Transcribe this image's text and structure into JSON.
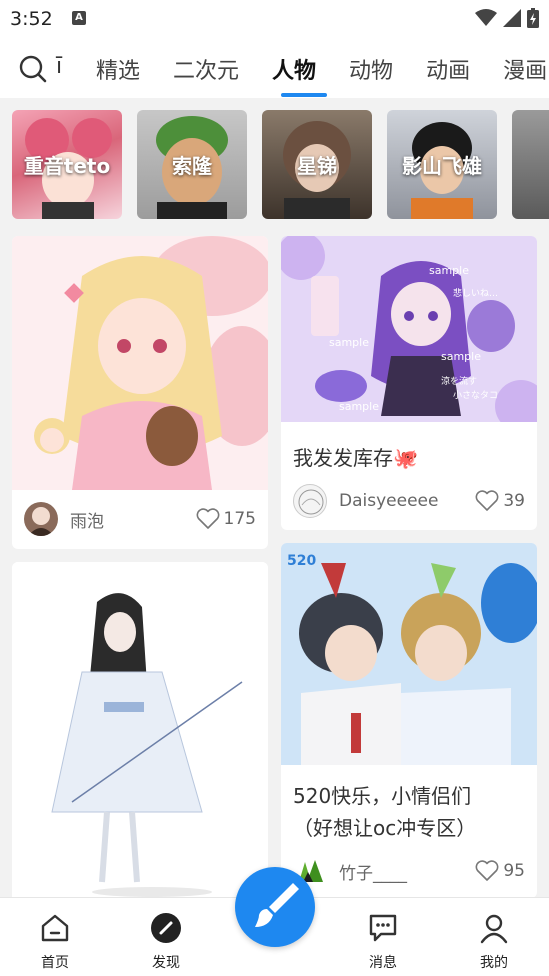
{
  "status_bar": {
    "time": "3:52",
    "notif_icon_letter": "A"
  },
  "tabs": {
    "partial_left": "ī",
    "items": [
      "精选",
      "二次元",
      "人物",
      "动物",
      "动画",
      "漫画"
    ],
    "active": "人物"
  },
  "characters": [
    {
      "label": "重音teto",
      "color": "#d9667a"
    },
    {
      "label": "索隆",
      "color": "#4d7a3a"
    },
    {
      "label": "星锑",
      "color": "#6b5a4c"
    },
    {
      "label": "影山飞雄",
      "color": "#4a4a52"
    },
    {
      "label": "",
      "color": "#8a8a8a"
    }
  ],
  "posts": [
    {
      "title": "",
      "author": "雨泡",
      "likes": "175"
    },
    {
      "title": "我发发库存🐙",
      "author": "Daisyeeeee",
      "likes": "39",
      "image_text": [
        "sample",
        "sample",
        "sample",
        "sample",
        "悲しいね…",
        "涼を流す",
        "小さなタコ"
      ]
    },
    {
      "title": "",
      "author": "",
      "likes": ""
    },
    {
      "title_line1": "520快乐，小情侣们",
      "title_line2": "（好想让oc冲专区）",
      "author": "竹子____",
      "likes": "95",
      "image_text": "520"
    }
  ],
  "bottom_nav": {
    "home": "首页",
    "discover": "发现",
    "messages": "消息",
    "mine": "我的"
  },
  "colors": {
    "accent": "#1e88f0"
  }
}
